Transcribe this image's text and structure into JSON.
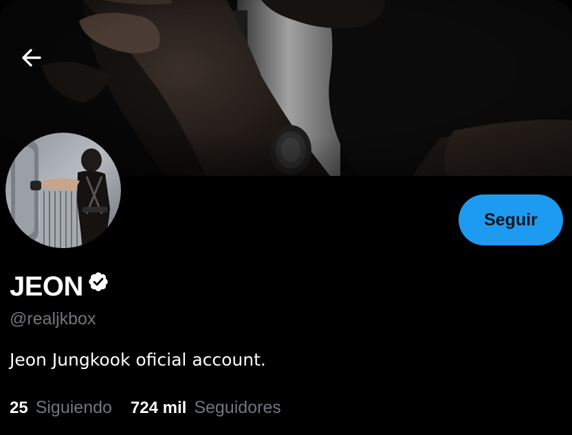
{
  "profile": {
    "display_name": "JEON",
    "handle": "@realjkbox",
    "bio": "Jeon Jungkook oficial account."
  },
  "actions": {
    "follow_label": "Seguir"
  },
  "stats": {
    "following_count": "25",
    "following_label": "Siguiendo",
    "followers_count": "724 mil",
    "followers_label": "Seguidores"
  },
  "icons": {
    "back": "arrow-left-icon",
    "verified": "verified-badge-icon"
  },
  "colors": {
    "background": "#000000",
    "accent": "#1d9bf0",
    "secondary_text": "#71767b",
    "primary_text": "#ffffff"
  }
}
